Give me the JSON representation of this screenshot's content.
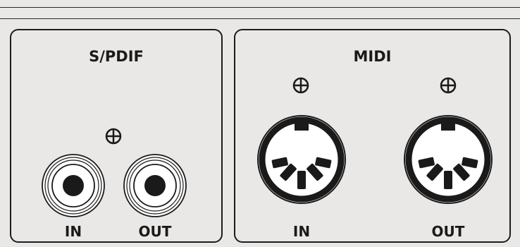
{
  "spdif": {
    "title": "S/PDIF",
    "in_label": "IN",
    "out_label": "OUT",
    "ground_icon": "circled-plus-icon"
  },
  "midi": {
    "title": "MIDI",
    "in_label": "IN",
    "out_label": "OUT",
    "ground_icon": "circled-plus-icon"
  },
  "colors": {
    "background": "#e9e8e6",
    "ink": "#1a1a1a"
  }
}
